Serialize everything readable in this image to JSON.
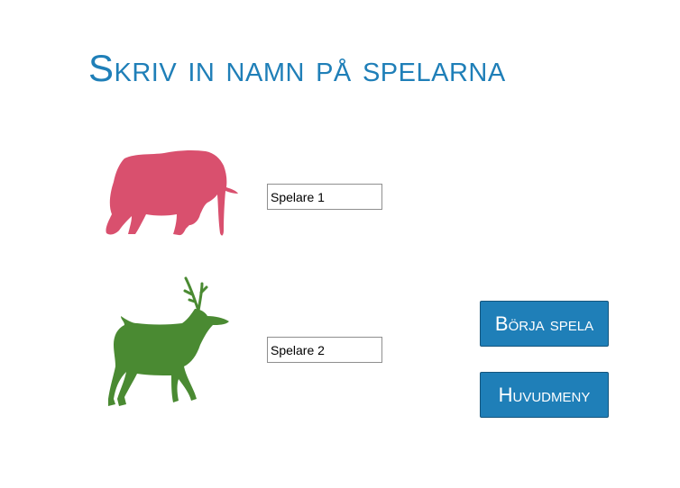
{
  "title": "Skriv in namn på spelarna",
  "players": [
    {
      "animal_icon": "elephant-icon",
      "color": "#d9506e",
      "name_value": "Spelare 1"
    },
    {
      "animal_icon": "deer-icon",
      "color": "#4a8a32",
      "name_value": "Spelare 2"
    }
  ],
  "buttons": {
    "start_label": "Börja spela",
    "main_menu_label": "Huvudmeny"
  },
  "colors": {
    "accent": "#1f7fb8",
    "background": "#ffffff"
  }
}
